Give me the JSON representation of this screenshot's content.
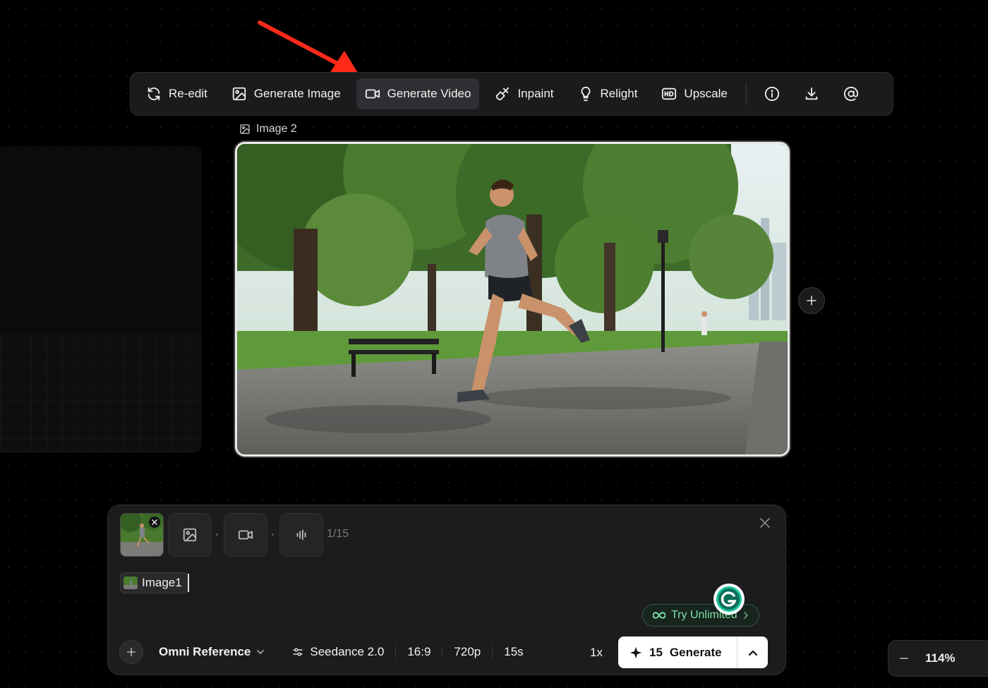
{
  "toolbar": {
    "items": [
      {
        "label": "Re-edit",
        "icon": "refresh-icon"
      },
      {
        "label": "Generate Image",
        "icon": "image-icon"
      },
      {
        "label": "Generate Video",
        "icon": "video-icon",
        "active": true
      },
      {
        "label": "Inpaint",
        "icon": "brush-icon"
      },
      {
        "label": "Relight",
        "icon": "lightbulb-icon"
      },
      {
        "label": "Upscale",
        "icon": "hd-icon"
      }
    ],
    "icon_buttons": [
      "info-icon",
      "download-icon",
      "at-icon"
    ]
  },
  "canvas": {
    "image_node_label": "Image 2"
  },
  "prompt_panel": {
    "counter": "1/15",
    "reference_chip": "Image1",
    "try_unlimited_label": "Try Unlimited",
    "mode": "Omni Reference",
    "model": "Seedance 2.0",
    "aspect_ratio": "16:9",
    "resolution": "720p",
    "duration": "15s",
    "quantity": "1x",
    "credits": "15",
    "generate_label": "Generate"
  },
  "zoom": {
    "level": "114%"
  },
  "colors": {
    "accent_green": "#7ee0a6",
    "annotation_red": "#ff2a1a"
  }
}
